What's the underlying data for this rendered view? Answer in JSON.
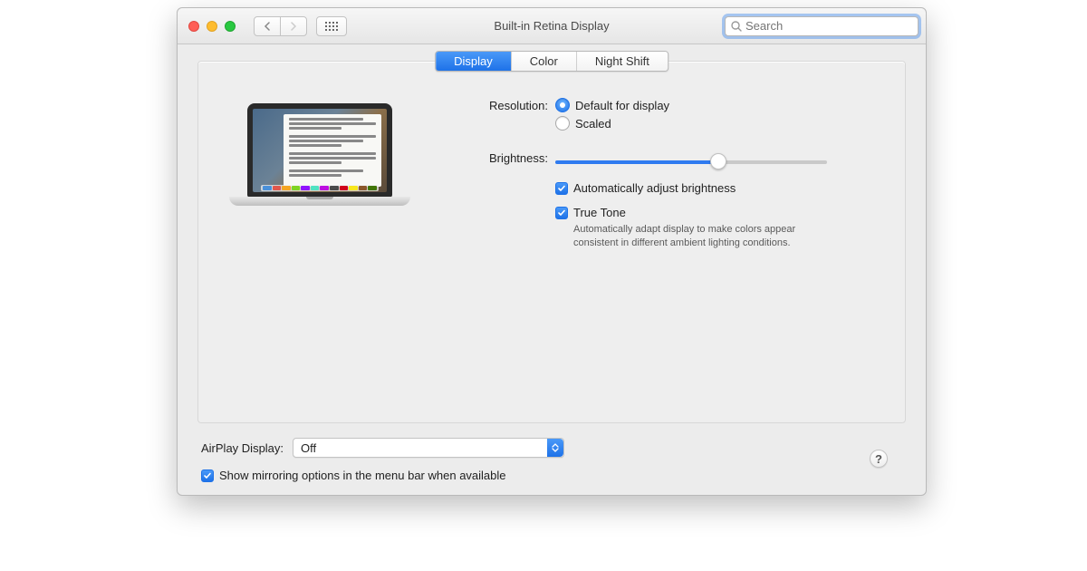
{
  "window": {
    "title": "Built-in Retina Display"
  },
  "search": {
    "placeholder": "Search"
  },
  "tabs": [
    {
      "label": "Display",
      "active": true
    },
    {
      "label": "Color",
      "active": false
    },
    {
      "label": "Night Shift",
      "active": false
    }
  ],
  "resolution": {
    "label": "Resolution:",
    "options": [
      {
        "label": "Default for display",
        "selected": true
      },
      {
        "label": "Scaled",
        "selected": false
      }
    ]
  },
  "brightness": {
    "label": "Brightness:",
    "value_pct": 60,
    "auto_adjust": {
      "label": "Automatically adjust brightness",
      "checked": true
    },
    "true_tone": {
      "label": "True Tone",
      "checked": true,
      "description": "Automatically adapt display to make colors appear consistent in different ambient lighting conditions."
    }
  },
  "airplay": {
    "label": "AirPlay Display:",
    "value": "Off"
  },
  "mirroring": {
    "label": "Show mirroring options in the menu bar when available",
    "checked": true
  },
  "help": "?"
}
